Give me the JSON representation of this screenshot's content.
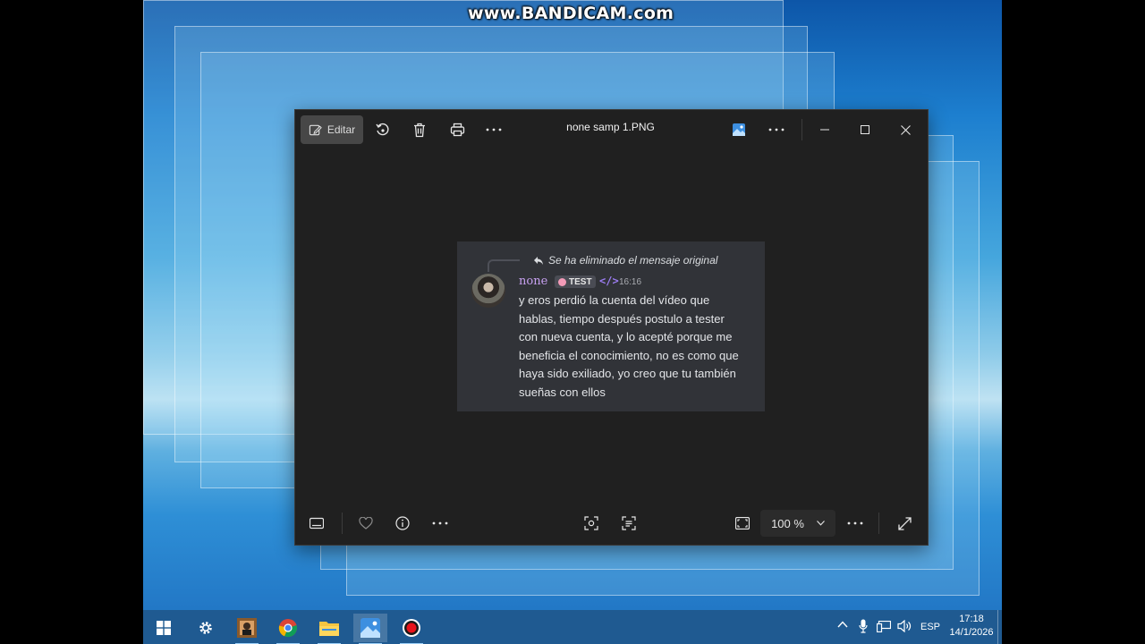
{
  "watermark": "www.BANDICAM.com",
  "viewer": {
    "edit_label": "Editar",
    "file_name": "none samp 1.PNG",
    "zoom_value": "100 %"
  },
  "message": {
    "reply_text": "Se ha eliminado el mensaje original",
    "username": "none",
    "tag": "TEST",
    "code_badge": "</>",
    "time": "16:16",
    "body": "y eros perdió la cuenta del vídeo que hablas, tiempo después postulo a tester con nueva cuenta, y lo acepté porque me beneficia el conocimiento, no es como que haya sido exiliado, yo creo que tu también sueñas con ellos"
  },
  "taskbar": {
    "language": "ESP",
    "time": "17:18",
    "date": "14/1/2026"
  },
  "icons": {
    "toolbar": [
      "edit-icon",
      "rotate-icon",
      "delete-icon",
      "print-icon",
      "more-icon"
    ],
    "titlebar": [
      "photos-app-icon",
      "more-icon",
      "minimize-icon",
      "maximize-icon",
      "close-icon"
    ],
    "bottom": [
      "filmstrip-icon",
      "favorite-icon",
      "info-icon",
      "more-icon",
      "visual-search-icon",
      "scan-text-icon",
      "fit-icon",
      "chevron-down-icon",
      "more-icon",
      "fullscreen-icon"
    ],
    "taskbar": [
      "windows-start-icon",
      "settings-icon",
      "photo-app-icon",
      "chrome-icon",
      "file-explorer-icon",
      "photos-icon",
      "bandicam-record-icon"
    ]
  }
}
